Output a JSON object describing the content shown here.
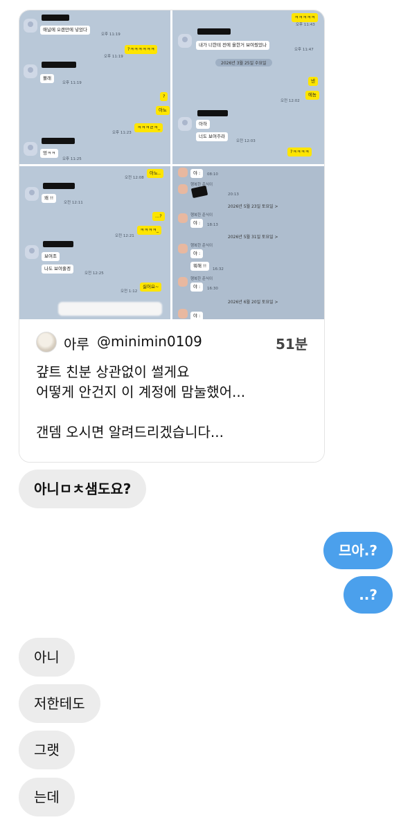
{
  "screenshot_panels": {
    "p1": {
      "msg1": "애널에 오랜만에 넣었다",
      "t1": "오후 11:19",
      "t2": "오후 11:19",
      "y1": "?ㅋㅋㅋㅋㅋㅋ",
      "msg2": "볼래",
      "t3": "오후 11:19",
      "y2": "?",
      "y3": "아뇨",
      "t4": "오후 11:23",
      "y4": "ㅋㅋㅋㄹㅋ_",
      "msg3": "엉ㅋㅋ",
      "t5": "오후 11:25"
    },
    "p2": {
      "y0": "ㅋㅋㅋㅋㅋ",
      "t0": "오후 11:43",
      "msg1": "내가 너한테 전에 올한거 보여줬었나",
      "t1": "오후 11:47",
      "date": "2026년 3월 25일 수요일",
      "y1": "넨",
      "t2": "오전 12:02",
      "y2": "에뇽",
      "msg2": "아하",
      "msg3": "너도 보여주라",
      "t3": "오전 12:03",
      "y3": "?ㅋㅋㅋㅋ"
    },
    "p3": {
      "t0": "오전 12:08",
      "y0": "아뇨..",
      "msg1": "왜 !!",
      "t1": "오전 12:11",
      "y1": "...?",
      "y2": "ㅋㅋㅋㅋ_",
      "t2": "오전 12:21",
      "msg2": "보여조",
      "msg3": "나도 보여줄겡",
      "t3": "오전 12:25",
      "t4": "오전 1:12",
      "y3": "싫어요~"
    },
    "p4": {
      "m1": "야 :",
      "t1": "08:10",
      "nick": "행복한 춘식이",
      "t2": "20:13",
      "d1": "2026년 5월 23일 토요일 >",
      "m2": "야 :",
      "t3": "18:13",
      "d2": "2026년 5월 31일 토요일 >",
      "m3": "야 :",
      "m4": "뭐해 !!",
      "t4": "16:32",
      "m5": "야 :",
      "t5": "16:30",
      "d3": "2026년 6월 20일 토요일 >",
      "m6": "야 :"
    }
  },
  "tweet": {
    "name": "아루",
    "handle": "@minimin0109",
    "time": "51분",
    "text": "걒트 친분 상관없이 썰게요\n어떻게 안건지 이 계정에 맘눌했어...\n\n갠뎀 오시면 알려드리겠습니다..."
  },
  "messages": {
    "in1": "아니ㅁㅊ샘도요?",
    "out1": "므아.?",
    "out2": "..?",
    "in2": "아니",
    "in3": "저한테도",
    "in4": "그랫",
    "in5": "는데"
  }
}
